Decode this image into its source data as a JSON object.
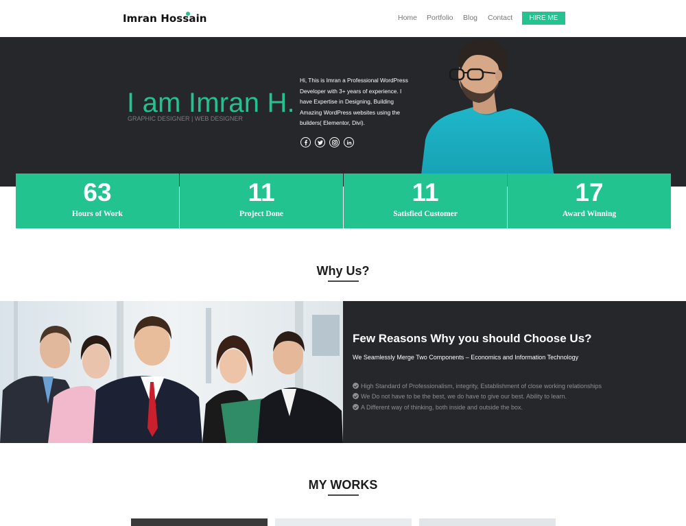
{
  "nav": {
    "brand": "Imran Hossain",
    "links": [
      "Home",
      "Portfolio",
      "Blog",
      "Contact"
    ],
    "hire_label": "HIRE ME"
  },
  "hero": {
    "title": "I am Imran H.",
    "subtitle": "GRAPHIC DESIGNER | WEB DESIGNER",
    "description": "Hi, This is Imran a Professional WordPress Developer with 3+ years of experience. I have Expertise in Designing, Building Amazing WordPress websites using the builders( Elementor, Divi).",
    "social": [
      "facebook-icon",
      "twitter-icon",
      "instagram-icon",
      "linkedin-icon"
    ]
  },
  "stats": [
    {
      "value": "63",
      "label": "Hours of Work"
    },
    {
      "value": "11",
      "label": "Project Done"
    },
    {
      "value": "11",
      "label": "Satisfied Customer"
    },
    {
      "value": "17",
      "label": "Award Winning"
    }
  ],
  "why": {
    "section_title": "Why Us?",
    "title": "Few Reasons Why you should Choose Us?",
    "subtitle": "We Seamlessly Merge Two Components – Economics and Information Technology",
    "items": [
      "High Standard of Professionalism, integrity, Establishment of close working relationships",
      "We Do not have to be the best, we do have to give our best. Ability to learn.",
      "A Different way of thinking, both inside and outside the box."
    ]
  },
  "works": {
    "section_title": "MY WORKS"
  },
  "colors": {
    "accent": "#22c38e",
    "dark": "#25272b"
  }
}
